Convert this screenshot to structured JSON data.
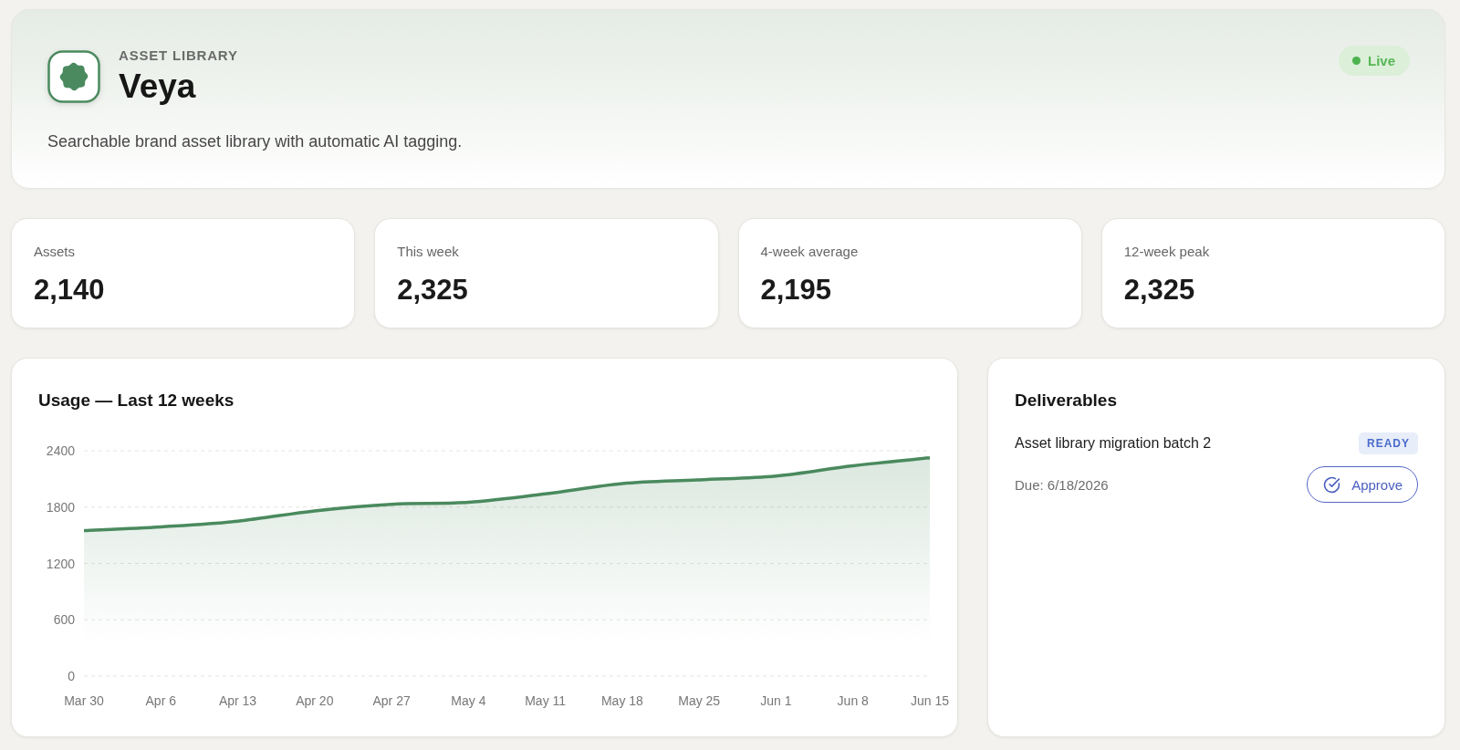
{
  "header": {
    "eyebrow": "ASSET LIBRARY",
    "title": "Veya",
    "description": "Searchable brand asset library with automatic AI tagging.",
    "status": {
      "label": "Live"
    }
  },
  "stats": [
    {
      "label": "Assets",
      "value": "2,140"
    },
    {
      "label": "This week",
      "value": "2,325"
    },
    {
      "label": "4-week average",
      "value": "2,195"
    },
    {
      "label": "12-week peak",
      "value": "2,325"
    }
  ],
  "usage": {
    "chart_data": {
      "type": "area",
      "title": "Usage — Last 12 weeks",
      "categories": [
        "Mar 30",
        "Apr 6",
        "Apr 13",
        "Apr 20",
        "Apr 27",
        "May 4",
        "May 11",
        "May 18",
        "May 25",
        "Jun 1",
        "Jun 8",
        "Jun 15"
      ],
      "series": [
        {
          "color": "#4a8a5e",
          "values": [
            1550,
            1590,
            1650,
            1760,
            1830,
            1850,
            1940,
            2050,
            2090,
            2130,
            2240,
            2325
          ]
        }
      ],
      "ylim": [
        0,
        2400
      ],
      "yticks": [
        0,
        600,
        1200,
        1800,
        2400
      ],
      "grid": true
    }
  },
  "deliverables": {
    "title": "Deliverables",
    "items": [
      {
        "name": "Asset library migration batch 2",
        "status": "READY",
        "due": "Due: 6/18/2026",
        "action": "Approve"
      }
    ]
  }
}
